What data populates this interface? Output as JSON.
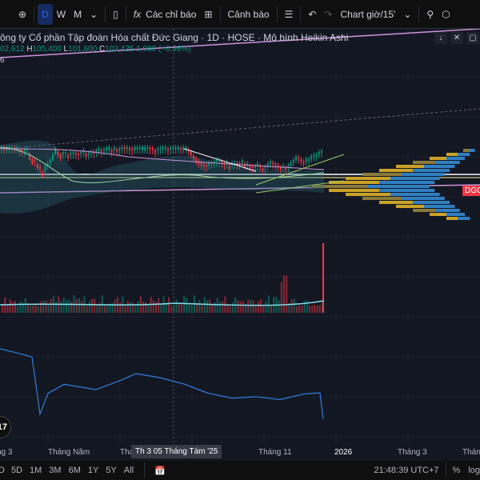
{
  "toolbar": {
    "intervals": [
      "D",
      "W",
      "M"
    ],
    "indicators": "Các chỉ báo",
    "alerts": "Cảnh báo",
    "layout": "Chart giờ/15'"
  },
  "legend": {
    "title": "ông ty Cổ phần Tập đoàn Hóa chất Đức Giang · 1D · HOSE · Mô hình Heikin Ashi",
    "o": "02,612",
    "h": "105,400",
    "l": "101,600",
    "c": "103,425",
    "change": "1,000 (+0,98%)",
    "level": "6"
  },
  "symbol_tag": "DGC",
  "time_axis": {
    "labels": [
      "ng 3",
      "Tháng Năm",
      "Thá",
      "Tháng 11",
      "2026",
      "Tháng 3",
      "Thán"
    ],
    "crosshair": "Th 3 05 Tháng Tám '25"
  },
  "bottom": {
    "ranges": [
      "D",
      "5D",
      "1M",
      "3M",
      "6M",
      "1Y",
      "5Y",
      "All"
    ],
    "clock": "21:48:39 UTC+7",
    "percent": "%",
    "log": "log"
  },
  "colors": {
    "bg": "#131722",
    "up": "#089981",
    "down": "#f23645",
    "accent": "#2962ff"
  }
}
